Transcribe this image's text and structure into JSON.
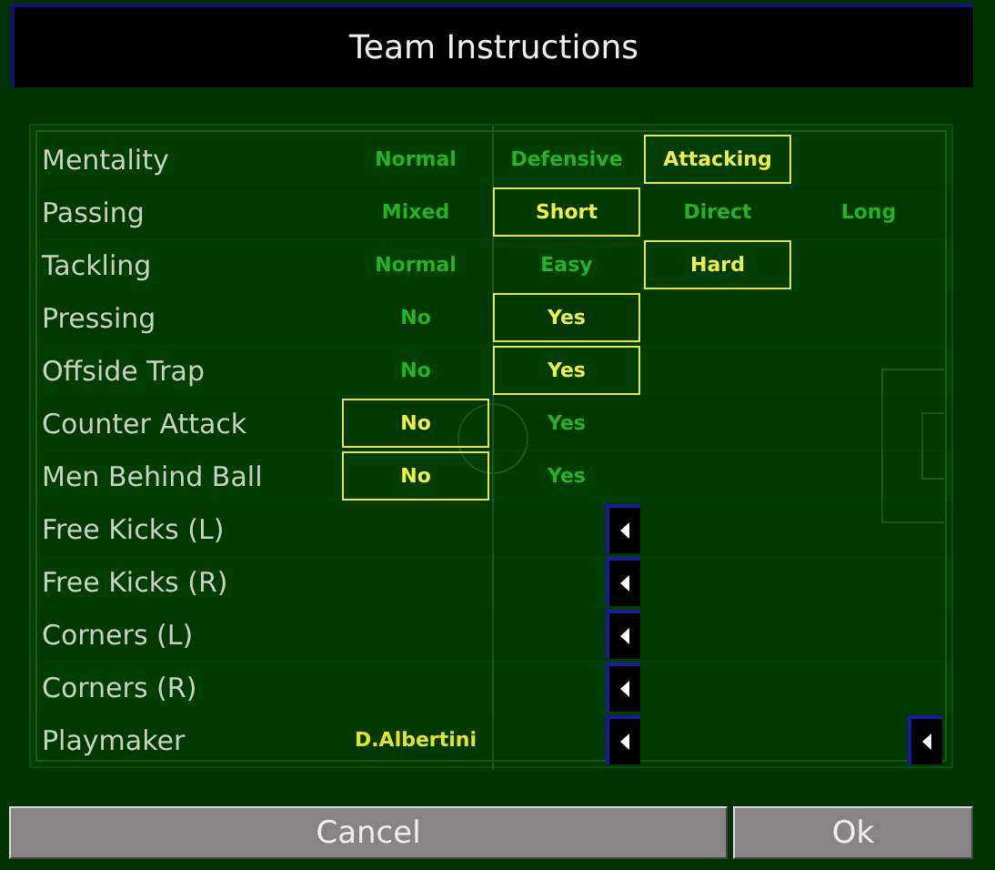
{
  "window": {
    "title": "Team Instructions"
  },
  "settings": [
    {
      "kind": "options",
      "label": "Mentality",
      "options": [
        {
          "label": "Normal",
          "selected": false
        },
        {
          "label": "Defensive",
          "selected": false
        },
        {
          "label": "Attacking",
          "selected": true
        }
      ]
    },
    {
      "kind": "options",
      "label": "Passing",
      "options": [
        {
          "label": "Mixed",
          "selected": false
        },
        {
          "label": "Short",
          "selected": true
        },
        {
          "label": "Direct",
          "selected": false
        },
        {
          "label": "Long",
          "selected": false
        }
      ]
    },
    {
      "kind": "options",
      "label": "Tackling",
      "options": [
        {
          "label": "Normal",
          "selected": false
        },
        {
          "label": "Easy",
          "selected": false
        },
        {
          "label": "Hard",
          "selected": true
        }
      ]
    },
    {
      "kind": "options",
      "label": "Pressing",
      "options": [
        {
          "label": "No",
          "selected": false
        },
        {
          "label": "Yes",
          "selected": true
        }
      ]
    },
    {
      "kind": "options",
      "label": "Offside Trap",
      "options": [
        {
          "label": "No",
          "selected": false
        },
        {
          "label": "Yes",
          "selected": true
        }
      ]
    },
    {
      "kind": "options",
      "label": "Counter Attack",
      "options": [
        {
          "label": "No",
          "selected": true
        },
        {
          "label": "Yes",
          "selected": false
        }
      ]
    },
    {
      "kind": "options",
      "label": "Men Behind Ball",
      "options": [
        {
          "label": "No",
          "selected": true
        },
        {
          "label": "Yes",
          "selected": false
        }
      ]
    },
    {
      "kind": "taker",
      "label": "Free Kicks (L)"
    },
    {
      "kind": "taker",
      "label": "Free Kicks (R)"
    },
    {
      "kind": "taker",
      "label": "Corners (L)"
    },
    {
      "kind": "taker",
      "label": "Corners (R)"
    },
    {
      "kind": "player",
      "label": "Playmaker",
      "value": "D.Albertini"
    }
  ],
  "buttons": [
    "Cancel",
    "Ok"
  ]
}
